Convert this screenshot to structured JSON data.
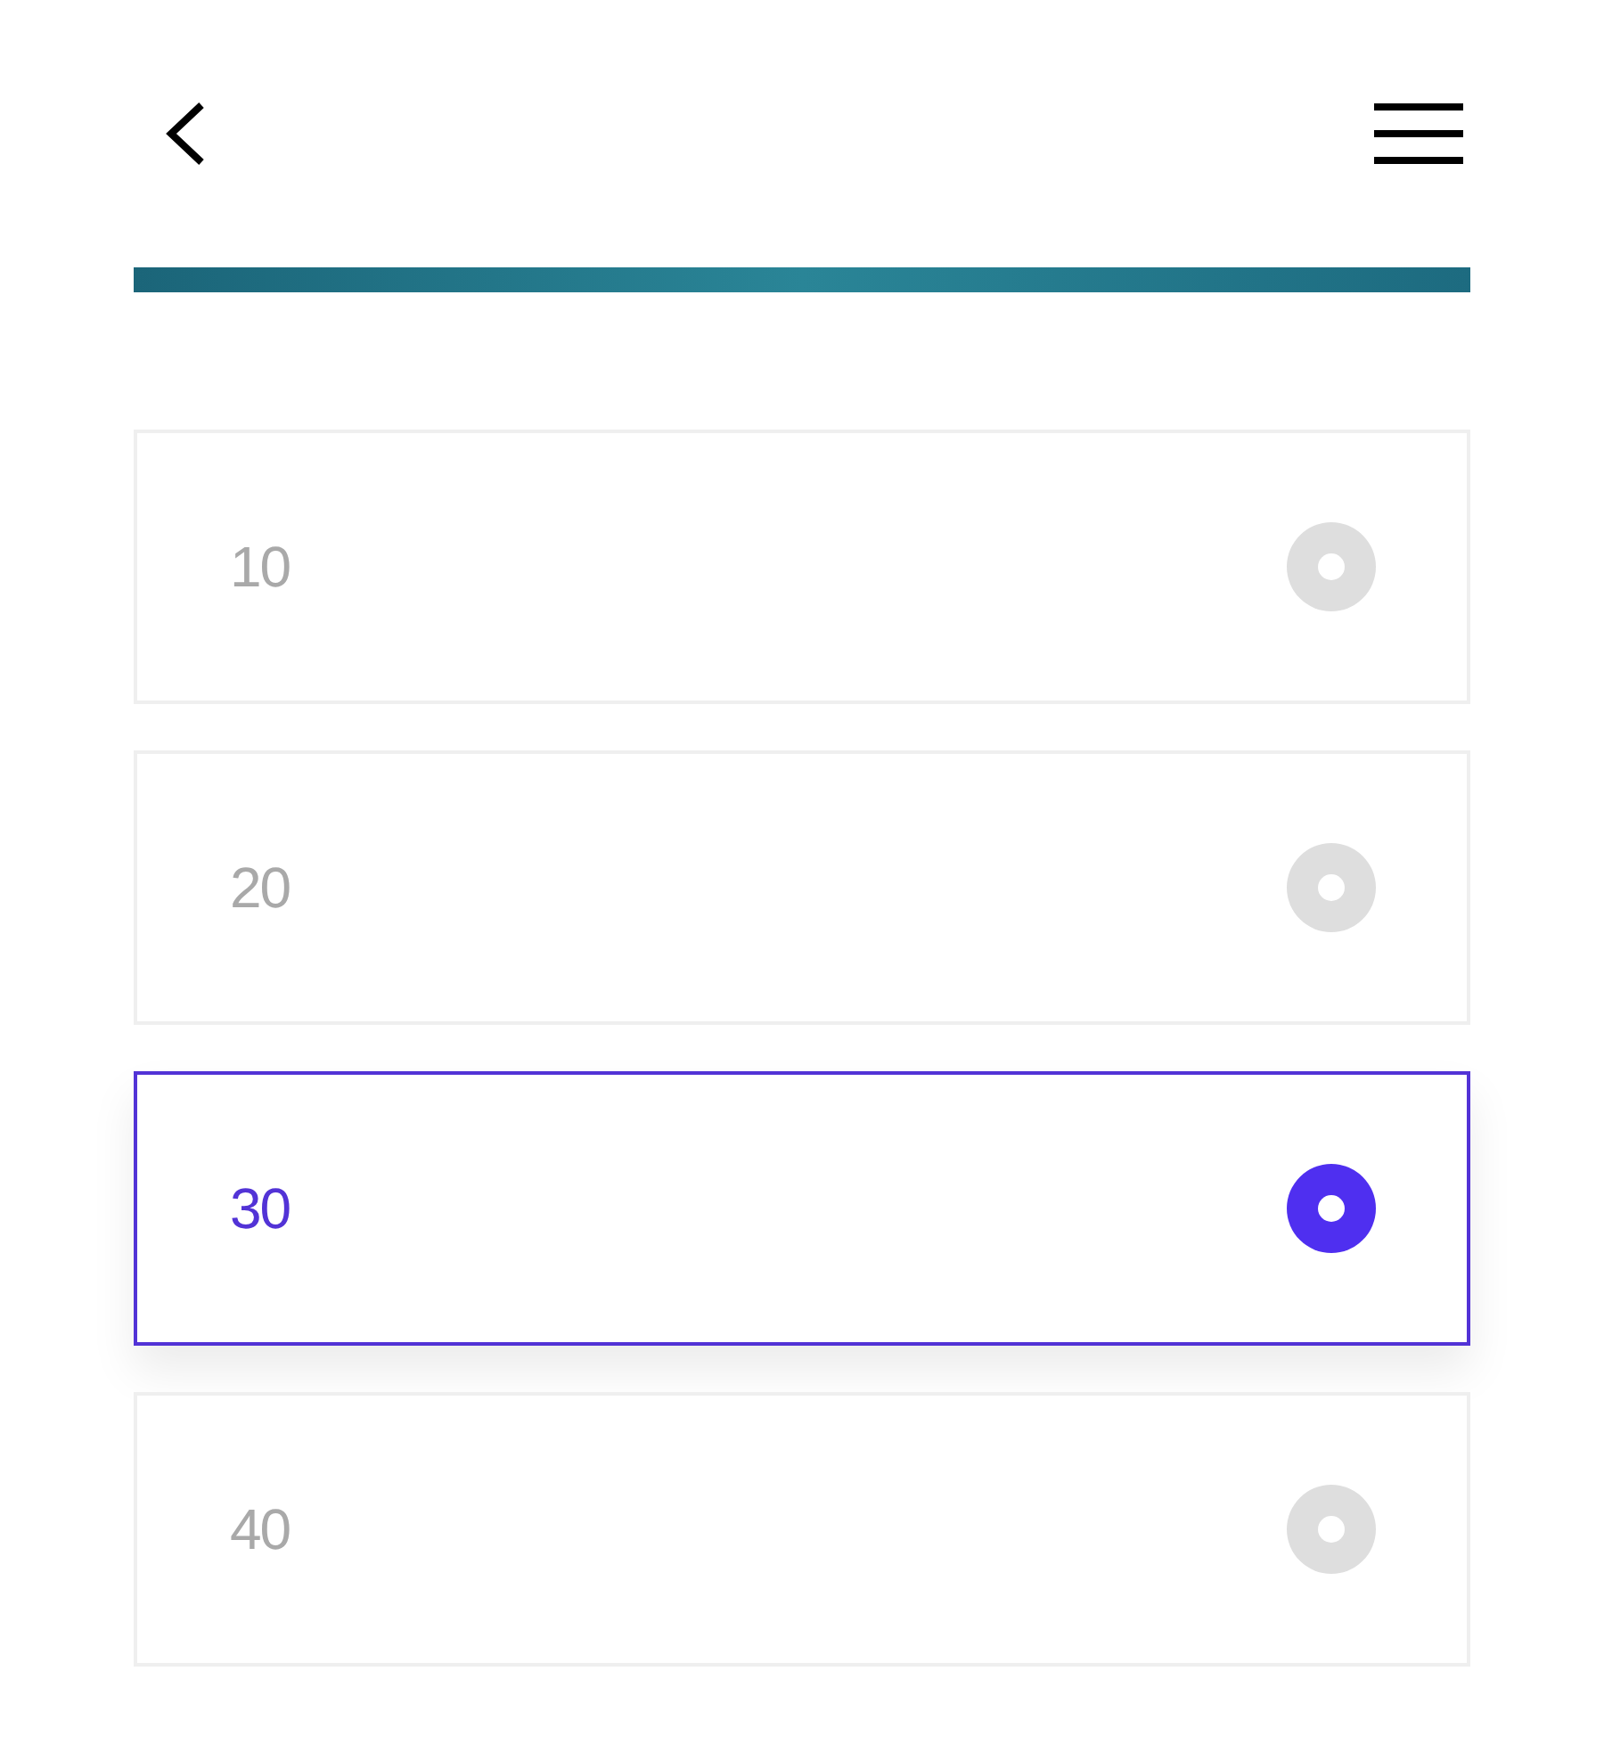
{
  "options": [
    {
      "label": "10",
      "selected": false
    },
    {
      "label": "20",
      "selected": false
    },
    {
      "label": "30",
      "selected": true
    },
    {
      "label": "40",
      "selected": false
    }
  ]
}
